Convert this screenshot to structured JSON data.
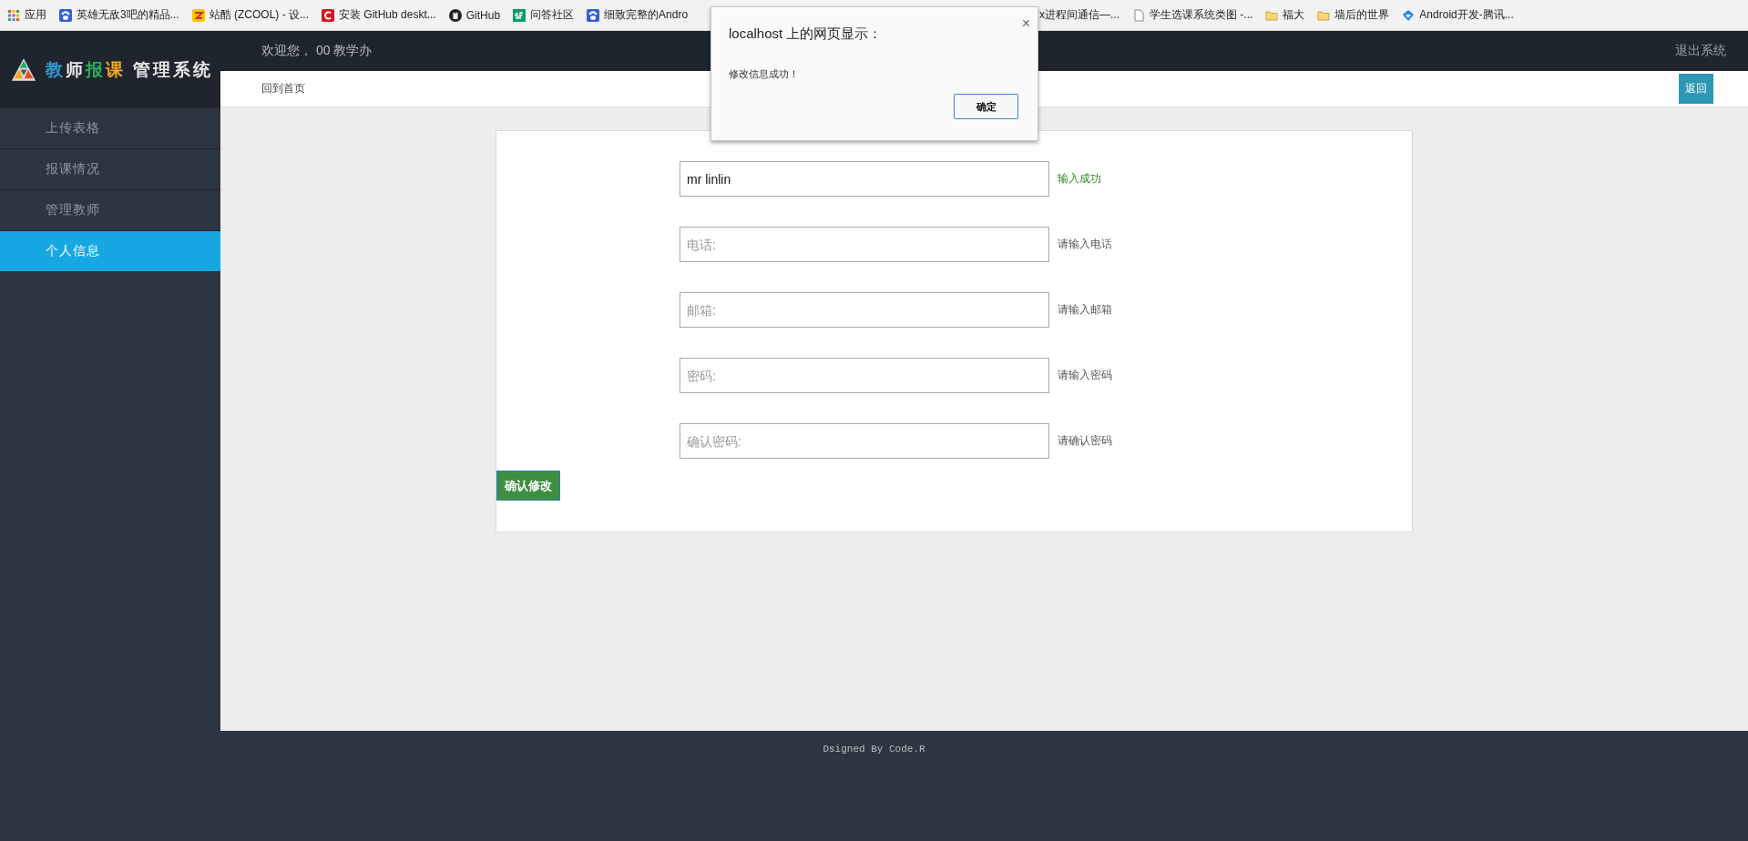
{
  "bookmarks": [
    {
      "label": "应用",
      "kind": "apps"
    },
    {
      "label": "英雄无敌3吧的精品...",
      "kind": "paw"
    },
    {
      "label": "站酷 (ZCOOL) - 设...",
      "kind": "zcool"
    },
    {
      "label": "安装 GitHub deskt...",
      "kind": "redc"
    },
    {
      "label": "GitHub",
      "kind": "github"
    },
    {
      "label": "问答社区",
      "kind": "sf"
    },
    {
      "label": "细致完整的Andro",
      "kind": "paw"
    }
  ],
  "bookmarks_right": [
    {
      "label": "x进程间通信—...",
      "kind": "none"
    },
    {
      "label": "学生选课系统类图 -...",
      "kind": "page"
    },
    {
      "label": "福大",
      "kind": "folder"
    },
    {
      "label": "墙后的世界",
      "kind": "folder"
    },
    {
      "label": "Android开发-腾讯...",
      "kind": "diamond"
    }
  ],
  "logo": {
    "parts": [
      {
        "text": "教",
        "color": "#2e9ad6"
      },
      {
        "text": "师",
        "color": "#e8e8e8"
      },
      {
        "text": "报",
        "color": "#27ae60"
      },
      {
        "text": "课",
        "color": "#f5a623"
      },
      {
        "text": " 管理系统",
        "color": "#e8e8e8"
      }
    ]
  },
  "sidebar": {
    "items": [
      {
        "label": "上传表格",
        "selected": false
      },
      {
        "label": "报课情况",
        "selected": false
      },
      {
        "label": "管理教师",
        "selected": false
      },
      {
        "label": "个人信息",
        "selected": true
      }
    ]
  },
  "header": {
    "welcome": "欢迎您， 00 教学办",
    "logout": "退出系统"
  },
  "subnav": {
    "home": "回到首页",
    "back": "返回"
  },
  "form": {
    "fields": [
      {
        "value": "mr linlin",
        "hint": "输入成功",
        "valid": true
      },
      {
        "placeholder": "电话:",
        "hint": "请输入电话",
        "valid": false
      },
      {
        "placeholder": "邮箱:",
        "hint": "请输入邮箱",
        "valid": false
      },
      {
        "placeholder": "密码:",
        "hint": "请输入密码",
        "valid": false
      },
      {
        "placeholder": "确认密码:",
        "hint": "请确认密码",
        "valid": false
      }
    ],
    "submit": "确认修改"
  },
  "dialog": {
    "title": "localhost 上的网页显示：",
    "close": "×",
    "message": "修改信息成功！",
    "ok": "确定"
  },
  "footer": "Dsigned By Code.R"
}
